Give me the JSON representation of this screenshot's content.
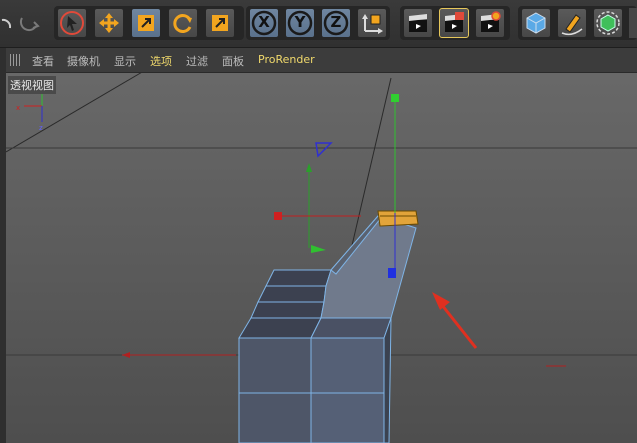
{
  "toolbar": {
    "buttons": [
      {
        "name": "undo-button"
      },
      {
        "name": "redo-button"
      },
      {
        "name": "select-tool-button"
      },
      {
        "name": "move-tool-button"
      },
      {
        "name": "scale-tool-button"
      },
      {
        "name": "rotate-tool-button"
      },
      {
        "name": "last-tool-button"
      },
      {
        "name": "x-axis-lock-button",
        "label": "X"
      },
      {
        "name": "y-axis-lock-button",
        "label": "Y"
      },
      {
        "name": "z-axis-lock-button",
        "label": "Z"
      },
      {
        "name": "coordinate-system-button"
      },
      {
        "name": "render-view-button"
      },
      {
        "name": "render-to-picture-viewer-button"
      },
      {
        "name": "render-settings-button"
      },
      {
        "name": "cube-primitive-button"
      },
      {
        "name": "pen-spline-button"
      },
      {
        "name": "subdivision-surface-button"
      }
    ],
    "accent": "#f2a51f"
  },
  "viewport": {
    "menu": [
      {
        "label": "查看"
      },
      {
        "label": "摄像机"
      },
      {
        "label": "显示"
      },
      {
        "label": "选项"
      },
      {
        "label": "过滤"
      },
      {
        "label": "面板"
      },
      {
        "label": "ProRender"
      }
    ],
    "view_name": "透视视图",
    "background": "#585858"
  }
}
